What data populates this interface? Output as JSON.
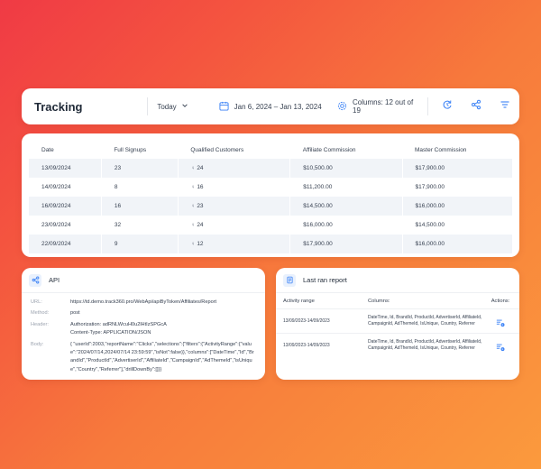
{
  "colors": {
    "accent": "#3b82f6",
    "row_shade": "#f1f4f8",
    "card": "#ffffff",
    "bg_start": "#f03a45",
    "bg_end": "#fb9a3d"
  },
  "topbar": {
    "title": "Tracking",
    "today_label": "Today",
    "date_range": "Jan 6, 2024 – Jan 13, 2024",
    "columns_label": "Columns: 12 out of 19",
    "icons": [
      "chevron-down-icon",
      "calendar-icon",
      "settings-icon",
      "refresh-cycle-icon",
      "share-icon",
      "filter-icon"
    ]
  },
  "table": {
    "headers": [
      "Date",
      "Full Signups",
      "Qualified Customers",
      "Affiliate Commission",
      "Master Commission"
    ],
    "rows": [
      [
        "13/09/2024",
        "23",
        "24",
        "$10,500.00",
        "$17,900.00"
      ],
      [
        "14/09/2024",
        "8",
        "16",
        "$11,200.00",
        "$17,900.00"
      ],
      [
        "16/09/2024",
        "16",
        "23",
        "$14,500.00",
        "$16,000.00"
      ],
      [
        "23/09/2024",
        "32",
        "24",
        "$16,000.00",
        "$14,500.00"
      ],
      [
        "22/09/2024",
        "9",
        "12",
        "$17,900.00",
        "$16,000.00"
      ]
    ]
  },
  "api": {
    "title": "API",
    "url_label": "URL:",
    "url_value": "https://td.demo.track360.pro/WebApi/apiByToken/Affiliates/Report",
    "method_label": "Method:",
    "method_value": "post",
    "header_label": "Header:",
    "header_value_1": "Authorization: adRNLWcuH0u2lHtIzSPGcA",
    "header_value_2": "Content-Type: APPLICATION/JSON",
    "body_label": "Body:",
    "body_value": "{ \"userId\":2003,\"reportName\":\"Clicks\",\"selections\":{\"filters\":{\"ActivityRange\":{\"value\":\"2024/07/14,2024/07/14 23:59:59\",\"isNot\":false}},\"columns\":[\"DateTime\",\"Id\",\"BrandId\",\"ProductId\",\"AdvertiserId\",\"AffiliateId\",\"CampaignId\",\"AdThemeId\",\"isUnique\",\"Country\",\"Referrer\"],\"drillDownBy\":[]}}"
  },
  "last_ran": {
    "title": "Last ran report",
    "col_activity": "Activity range",
    "col_columns": "Columns:",
    "col_actions": "Actions:",
    "rows": [
      {
        "range": "13/09/2023-14/09/2023",
        "columns": "DateTime, Id, BrandId, ProductId, AdvertiserId, AffiliateId, CampaignId, AdThemeId, IsUnique, Country, Referrer"
      },
      {
        "range": "13/09/2023-14/09/2023",
        "columns": "DateTime, Id, BrandId, ProductId, AdvertiserId, AffiliateId, CampaignId, AdThemeId, IsUnique, Country, Referrer"
      }
    ]
  }
}
